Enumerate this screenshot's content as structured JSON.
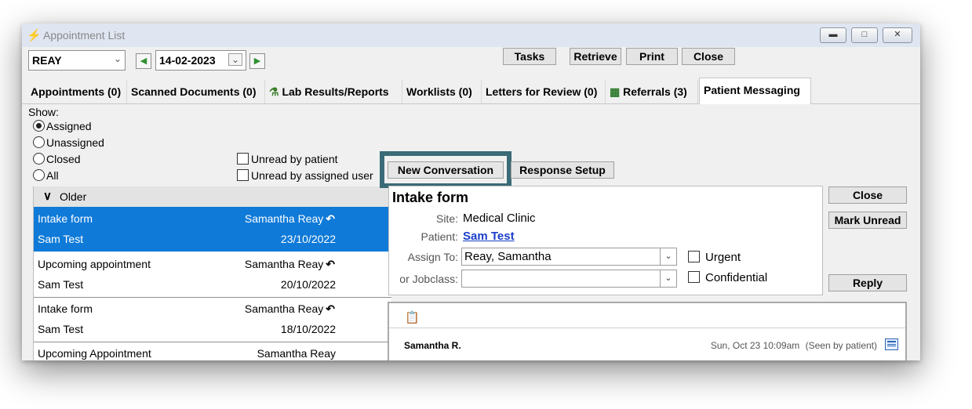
{
  "window": {
    "title": "Appointment List",
    "controls": [
      "minimize",
      "maximize",
      "close"
    ]
  },
  "toolbar": {
    "provider": "REAY",
    "date": "14-02-2023",
    "buttons": [
      "Tasks",
      "Retrieve",
      "Print",
      "Close"
    ]
  },
  "tabs": [
    {
      "label": "Appointments (0)"
    },
    {
      "label": "Scanned Documents (0)"
    },
    {
      "label": "Lab Results/Reports",
      "icon": "lab-results-icon"
    },
    {
      "label": "Worklists (0)"
    },
    {
      "label": "Letters for Review (0)"
    },
    {
      "label": "Referrals (3)",
      "icon": "referrals-icon"
    },
    {
      "label": "Patient Messaging",
      "active": true
    }
  ],
  "filters": {
    "show_label": "Show:",
    "options": [
      "Assigned",
      "Unassigned",
      "Closed",
      "All"
    ],
    "selected": "Assigned",
    "checkboxes": [
      "Unread by patient",
      "Unread by assigned user"
    ]
  },
  "list": {
    "group_label": "Older",
    "items": [
      {
        "subject": "Intake form",
        "sender": "Samantha Reay",
        "replied": true,
        "patient": "Sam Test",
        "date": "23/10/2022",
        "selected": true
      },
      {
        "subject": "Upcoming appointment",
        "sender": "Samantha Reay",
        "replied": true,
        "patient": "Sam Test",
        "date": "20/10/2022",
        "selected": false
      },
      {
        "subject": "Intake form",
        "sender": "Samantha Reay",
        "replied": true,
        "patient": "Sam Test",
        "date": "18/10/2022",
        "selected": false
      },
      {
        "subject": "Upcoming Appointment",
        "sender": "Samantha Reay",
        "replied": false,
        "patient": "",
        "date": "",
        "selected": false
      }
    ]
  },
  "actions": {
    "new_conversation": "New Conversation",
    "response_setup": "Response Setup"
  },
  "detail": {
    "title": "Intake form",
    "site_label": "Site:",
    "site": "Medical Clinic",
    "patient_label": "Patient:",
    "patient": "Sam Test",
    "assign_label": "Assign To:",
    "assign_value": "Reay, Samantha",
    "jobclass_label": "or Jobclass:",
    "jobclass_value": "",
    "urgent_label": "Urgent",
    "confidential_label": "Confidential"
  },
  "side_buttons": {
    "close": "Close",
    "mark_unread": "Mark Unread",
    "reply": "Reply"
  },
  "message": {
    "author": "Samantha R.",
    "timestamp": "Sun, Oct 23 10:09am",
    "status": "(Seen by patient)"
  },
  "colors": {
    "selection": "#0f7ad8",
    "highlight_border": "#3a6b76",
    "link": "#1a3ec9"
  }
}
